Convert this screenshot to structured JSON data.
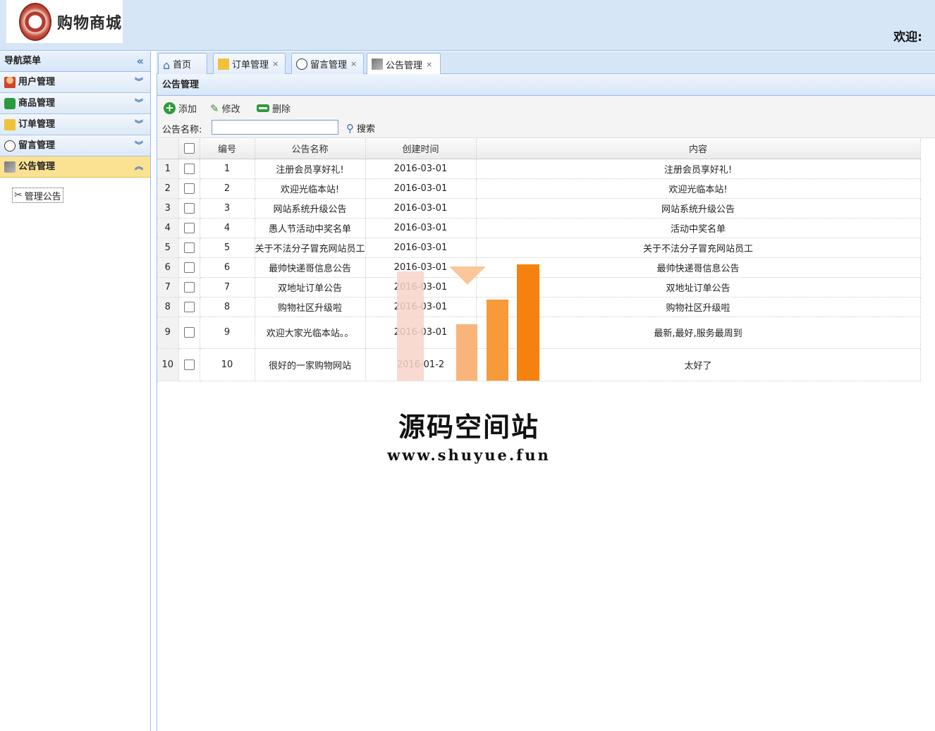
{
  "header": {
    "logo_text": "购物商城",
    "welcome": "欢迎:"
  },
  "sidebar": {
    "title": "导航菜单",
    "collapse_icon": "«",
    "items": [
      {
        "label": "用户管理",
        "icon": "user-icon",
        "chev": "︾"
      },
      {
        "label": "商品管理",
        "icon": "goods-icon",
        "chev": "︾"
      },
      {
        "label": "订单管理",
        "icon": "order-icon",
        "chev": "︾"
      },
      {
        "label": "留言管理",
        "icon": "message-icon",
        "chev": "︾"
      },
      {
        "label": "公告管理",
        "icon": "notice-icon",
        "chev": "︽"
      }
    ],
    "sub_item": "管理公告"
  },
  "tabs": [
    {
      "label": "首页",
      "close": ""
    },
    {
      "label": "订单管理",
      "close": "×"
    },
    {
      "label": "留言管理",
      "close": "×"
    },
    {
      "label": "公告管理",
      "close": "×"
    }
  ],
  "panel": {
    "title": "公告管理"
  },
  "toolbar": {
    "add": "添加",
    "edit": "修改",
    "delete": "删除"
  },
  "search": {
    "label": "公告名称:",
    "value": "",
    "placeholder": "",
    "button": "搜索"
  },
  "grid": {
    "columns": {
      "id": "编号",
      "name": "公告名称",
      "time": "创建时间",
      "content": "内容"
    },
    "rows": [
      {
        "num": "1",
        "id": "1",
        "name": "注册会员享好礼!",
        "time": "2016-03-01",
        "content": "注册会员享好礼!"
      },
      {
        "num": "2",
        "id": "2",
        "name": "欢迎光临本站!",
        "time": "2016-03-01",
        "content": "欢迎光临本站!"
      },
      {
        "num": "3",
        "id": "3",
        "name": "网站系统升级公告",
        "time": "2016-03-01",
        "content": "网站系统升级公告"
      },
      {
        "num": "4",
        "id": "4",
        "name": "愚人节活动中奖名单",
        "time": "2016-03-01",
        "content": "活动中奖名单"
      },
      {
        "num": "5",
        "id": "5",
        "name": "关于不法分子冒充网站员工",
        "time": "2016-03-01",
        "content": "关于不法分子冒充网站员工"
      },
      {
        "num": "6",
        "id": "6",
        "name": "最帅快递哥信息公告",
        "time": "2016-03-01",
        "content": "最帅快递哥信息公告"
      },
      {
        "num": "7",
        "id": "7",
        "name": "双地址订单公告",
        "time": "2016-03-01",
        "content": "双地址订单公告"
      },
      {
        "num": "8",
        "id": "8",
        "name": "购物社区升级啦",
        "time": "2016-03-01",
        "content": "购物社区升级啦"
      },
      {
        "num": "9",
        "id": "9",
        "name": "欢迎大家光临本站。。",
        "time": "2016-03-01",
        "content": "最新,最好,服务最周到"
      },
      {
        "num": "10",
        "id": "10",
        "name": "很好的一家购物网站",
        "time": "2016-01-2",
        "content": "太好了"
      }
    ]
  },
  "watermark": {
    "title": "源码空间站",
    "url": "www.shuyue.fun",
    "colors": [
      "#f7d4c9",
      "#f9b47a",
      "#f79a3a",
      "#f5820f"
    ]
  }
}
